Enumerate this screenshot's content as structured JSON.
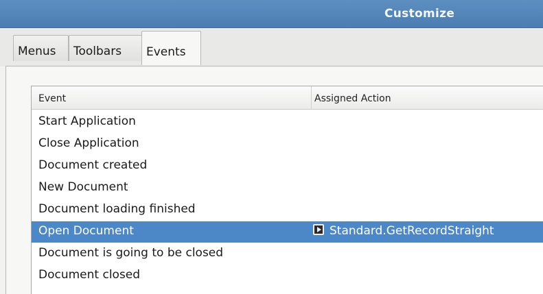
{
  "window": {
    "title": "Customize"
  },
  "tabs": [
    {
      "label": "Menus"
    },
    {
      "label": "Toolbars"
    },
    {
      "label": "Events",
      "active": true
    }
  ],
  "events_table": {
    "columns": {
      "event": "Event",
      "action": "Assigned Action"
    },
    "rows": [
      {
        "event": "Start Application",
        "action": ""
      },
      {
        "event": "Close Application",
        "action": ""
      },
      {
        "event": "Document created",
        "action": ""
      },
      {
        "event": "New Document",
        "action": ""
      },
      {
        "event": "Document loading finished",
        "action": ""
      },
      {
        "event": "Open Document",
        "action": "Standard.GetRecordStraight",
        "selected": true,
        "action_icon": "macro-icon"
      },
      {
        "event": "Document is going to be closed",
        "action": ""
      },
      {
        "event": "Document closed",
        "action": ""
      }
    ]
  },
  "colors": {
    "selection": "#4c87c8",
    "titlebar": "#5585b8"
  }
}
